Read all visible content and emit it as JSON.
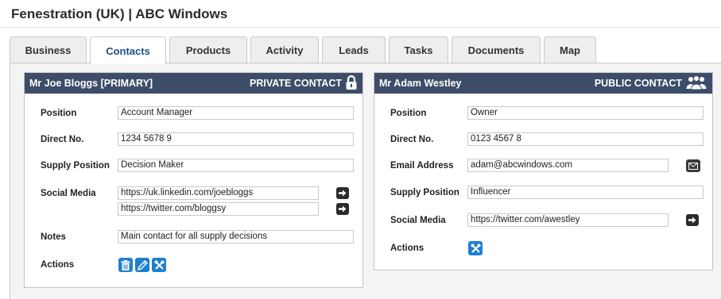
{
  "page": {
    "title": "Fenestration (UK) | ABC Windows"
  },
  "tabs": [
    {
      "label": "Business"
    },
    {
      "label": "Contacts"
    },
    {
      "label": "Products"
    },
    {
      "label": "Activity"
    },
    {
      "label": "Leads"
    },
    {
      "label": "Tasks"
    },
    {
      "label": "Documents"
    },
    {
      "label": "Map"
    }
  ],
  "active_tab": "Contacts",
  "colors": {
    "header_bg": "#3d4d69",
    "active_tab_text": "#1c4f8a",
    "action_blue": "#1f7fcf"
  },
  "contacts": [
    {
      "name": "Mr Joe Bloggs [PRIMARY]",
      "visibility": "PRIVATE CONTACT",
      "visibility_icon": "padlock-icon",
      "position_label": "Position",
      "position": "Account Manager",
      "direct_label": "Direct No.",
      "direct": "1234 5678 9",
      "supply_label": "Supply Position",
      "supply": "Decision Maker",
      "social_label": "Social Media",
      "social": [
        "https://uk.linkedin.com/joebloggs",
        "https://twitter.com/bloggsy"
      ],
      "notes_label": "Notes",
      "notes": "Main contact for all supply decisions",
      "actions_label": "Actions",
      "actions": [
        "trash-icon",
        "pencil-icon",
        "tools-icon"
      ]
    },
    {
      "name": "Mr Adam Westley",
      "visibility": "PUBLIC CONTACT",
      "visibility_icon": "group-icon",
      "position_label": "Position",
      "position": "Owner",
      "direct_label": "Direct No.",
      "direct": "0123 4567 8",
      "email_label": "Email Address",
      "email": "adam@abcwindows.com",
      "supply_label": "Supply Position",
      "supply": "Influencer",
      "social_label": "Social Media",
      "social": [
        "https://twitter.com/awestley"
      ],
      "actions_label": "Actions",
      "actions": [
        "tools-icon"
      ]
    }
  ]
}
